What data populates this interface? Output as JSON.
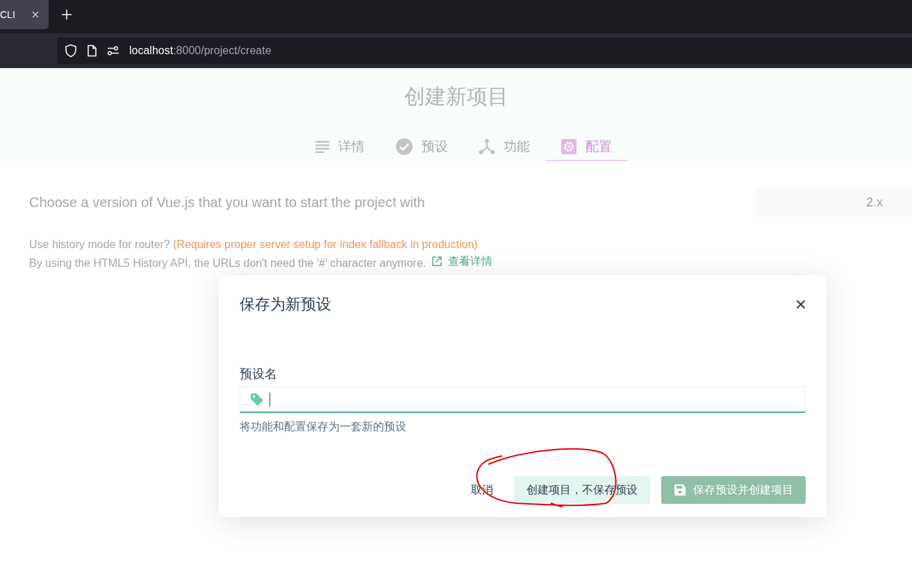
{
  "browser": {
    "tab": {
      "title": "CLI"
    },
    "url": {
      "host": "localhost",
      "path": ":8000/project/create"
    }
  },
  "page": {
    "title": "创建新项目",
    "steps": [
      {
        "label": "详情",
        "selected": false
      },
      {
        "label": "预设",
        "selected": false
      },
      {
        "label": "功能",
        "selected": false
      },
      {
        "label": "配置",
        "selected": true
      }
    ],
    "version_prompt": {
      "label": "Choose a version of Vue.js that you want to start the project with",
      "value": "2.x"
    },
    "history_mode": {
      "label": "Use history mode for router?",
      "note": "(Requires proper server setup for index fallback in production)",
      "description": "By using the HTML5 History API, the URLs don't need the '#' character anymore.",
      "link": "查看详情"
    }
  },
  "dialog": {
    "title": "保存为新预设",
    "field": {
      "label": "预设名",
      "focused": true,
      "hint": "将功能和配置保存为一套新的预设"
    },
    "buttons": [
      {
        "label": "取消",
        "kind": "flat",
        "disabled": false
      },
      {
        "label": "创建项目，不保存预设",
        "kind": "light",
        "disabled": false
      },
      {
        "label": "保存预设并创建项目",
        "kind": "primary",
        "disabled": true
      }
    ]
  }
}
